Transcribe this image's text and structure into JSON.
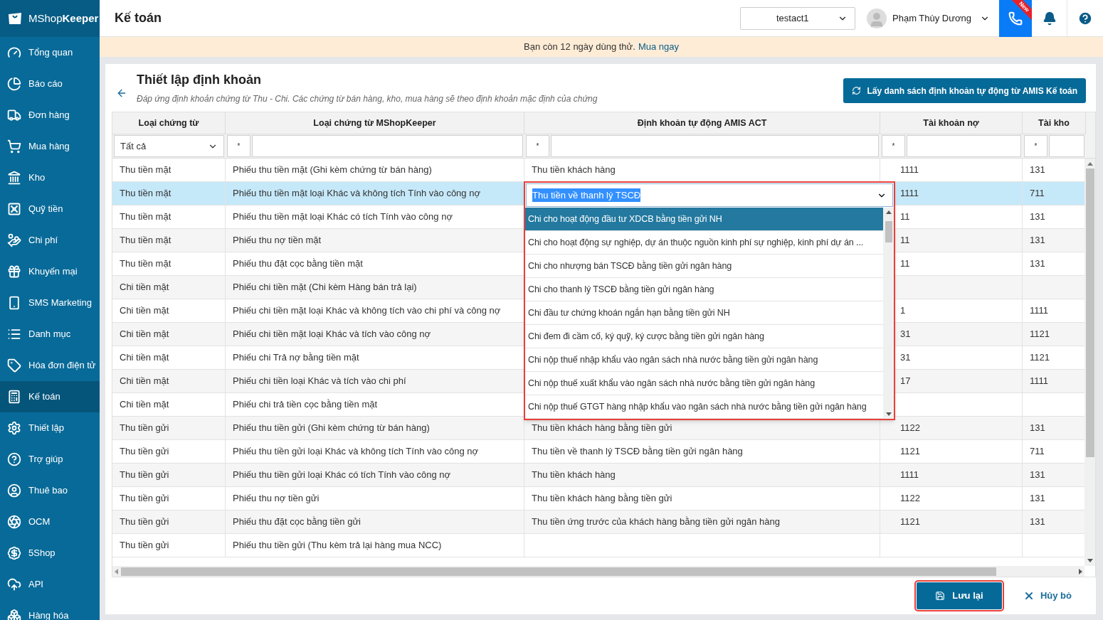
{
  "sidebar": {
    "logo": "MShop**Keeper**",
    "items": [
      {
        "label": "Tổng quan",
        "selected": false
      },
      {
        "label": "Báo cáo",
        "selected": false
      },
      {
        "label": "Đơn hàng",
        "selected": false
      },
      {
        "label": "Mua hàng",
        "selected": false
      },
      {
        "label": "Kho",
        "selected": false
      },
      {
        "label": "Quỹ tiền",
        "selected": false
      },
      {
        "label": "Chi phí",
        "selected": false
      },
      {
        "label": "Khuyến mại",
        "selected": false
      },
      {
        "label": "SMS Marketing",
        "selected": false
      },
      {
        "label": "Danh mục",
        "selected": false
      },
      {
        "label": "Hóa đơn điện tử",
        "selected": false
      },
      {
        "label": "Kế toán",
        "selected": true
      },
      {
        "label": "Thiết lập",
        "selected": false
      },
      {
        "label": "Trợ giúp",
        "selected": false
      },
      {
        "label": "Thuê bao",
        "selected": false
      },
      {
        "label": "OCM",
        "selected": false
      },
      {
        "label": "5Shop",
        "selected": false
      },
      {
        "label": "API",
        "selected": false
      },
      {
        "label": "Hàng hóa",
        "selected": false
      }
    ]
  },
  "topbar": {
    "title": "Kế toán",
    "account": "testact1",
    "user": "Phạm Thùy Dương",
    "new_badge": "New"
  },
  "notice": {
    "text": "Bạn còn 12 ngày dùng thử.",
    "link": "Mua ngay"
  },
  "page": {
    "title": "Thiết lập định khoản",
    "subtitle": "Đáp ứng định khoản chứng từ Thu - Chi. Các chứng từ bán hàng, kho, mua hàng sẽ theo định khoản mặc định của chứng",
    "fetch_button": "Lấy danh sách định khoản tự động từ AMIS Kế toán"
  },
  "table": {
    "columns": [
      "Loại chứng từ",
      "Loại chứng từ MShopKeeper",
      "Định khoản tự động AMIS ACT",
      "Tài khoản nợ",
      "Tài kho"
    ],
    "filters": [
      {
        "kind": "select",
        "value": "Tất cả"
      },
      {
        "kind": "text",
        "operator": "*"
      },
      {
        "kind": "text",
        "operator": "*"
      },
      {
        "kind": "text",
        "operator": "*"
      },
      {
        "kind": "text",
        "operator": "*"
      }
    ],
    "rows": [
      {
        "type": "Thu tiền mặt",
        "doc": "Phiếu thu tiền mặt (Ghi kèm chứng từ bán hàng)",
        "amis": "Thu tiền khách hàng",
        "debit": "1111",
        "credit": "131",
        "selected": false
      },
      {
        "type": "Thu tiền mặt",
        "doc": "Phiếu thu tiền mặt loại Khác và không tích Tính vào công nợ",
        "debit": "1111",
        "credit": "711",
        "selected": true
      },
      {
        "type": "Thu tiền mặt",
        "doc": "Phiếu thu tiền mặt loại Khác có tích Tính vào công nợ",
        "debit": "11",
        "credit": "131",
        "selected": false
      },
      {
        "type": "Thu tiền mặt",
        "doc": "Phiếu thu nợ tiền mặt",
        "debit": "11",
        "credit": "131",
        "selected": false
      },
      {
        "type": "Thu tiền mặt",
        "doc": "Phiếu thu đặt cọc bằng tiền mặt",
        "debit": "11",
        "credit": "131",
        "selected": false
      },
      {
        "type": "Chi tiền mặt",
        "doc": "Phiếu chi tiền mặt (Chi kèm Hàng bán trả lại)",
        "selected": false
      },
      {
        "type": "Chi tiền mặt",
        "doc": "Phiếu chi tiền mặt loại Khác và không tích vào chi phí và công nợ",
        "debit": "1",
        "credit": "1111",
        "selected": false
      },
      {
        "type": "Chi tiền mặt",
        "doc": "Phiếu chi tiền mặt loại Khác và tích vào công nợ",
        "debit": "31",
        "credit": "1121",
        "selected": false
      },
      {
        "type": "Chi tiền mặt",
        "doc": "Phiếu chi Trả nợ bằng tiền mặt",
        "debit": "31",
        "credit": "1121",
        "selected": false
      },
      {
        "type": "Chi tiền mặt",
        "doc": "Phiếu chi tiền loại Khác và tích vào chi phí",
        "debit": "17",
        "credit": "1111",
        "selected": false
      },
      {
        "type": "Chi tiền mặt",
        "doc": "Phiếu chi trả tiền cọc bằng tiền mặt",
        "selected": false
      },
      {
        "type": "Thu tiền gửi",
        "doc": "Phiếu thu tiền gửi (Ghi kèm chứng từ bán hàng)",
        "amis": "Thu tiền khách hàng bằng tiền gửi",
        "debit": "1122",
        "credit": "131",
        "selected": false
      },
      {
        "type": "Thu tiền gửi",
        "doc": "Phiếu thu tiền gửi loại Khác và không tích Tính vào công nợ",
        "amis": "Thu tiền về thanh lý TSCĐ bằng tiền gửi ngân hàng",
        "debit": "1121",
        "credit": "711",
        "selected": false
      },
      {
        "type": "Thu tiền gửi",
        "doc": "Phiếu thu tiền gửi loại Khác có tích Tính vào công nợ",
        "amis": "Thu tiền khách hàng",
        "debit": "1111",
        "credit": "131",
        "selected": false
      },
      {
        "type": "Thu tiền gửi",
        "doc": "Phiếu thu nợ tiền gửi",
        "amis": "Thu tiền khách hàng bằng tiền gửi",
        "debit": "1122",
        "credit": "131",
        "selected": false
      },
      {
        "type": "Thu tiền gửi",
        "doc": "Phiếu thu đặt cọc bằng tiền gửi",
        "amis": "Thu tiền ứng trước của khách hàng bằng tiền gửi ngân hàng",
        "debit": "1121",
        "credit": "131",
        "selected": false
      },
      {
        "type": "Thu tiền gửi",
        "doc": "Phiếu thu tiền gửi (Thu kèm trả lại hàng mua NCC)",
        "selected": false
      }
    ],
    "dropdown": {
      "value": "Thu tiền về thanh lý TSCĐ",
      "options": [
        {
          "label": "Chi cho hoạt động đầu tư XDCB bằng tiền gửi NH",
          "selected": true
        },
        {
          "label": "Chi cho hoạt động sự nghiệp, dự án thuộc nguồn kinh phí sự nghiệp, kinh phí dự án ...",
          "selected": false
        },
        {
          "label": "Chi cho nhượng bán TSCĐ bằng tiền gửi ngân hàng",
          "selected": false
        },
        {
          "label": "Chi cho thanh lý TSCĐ bằng tiền gửi ngân hàng",
          "selected": false
        },
        {
          "label": "Chi đầu tư chứng khoán ngắn hạn bằng tiền gửi NH",
          "selected": false
        },
        {
          "label": "Chi đem đi cầm cố, ký quỹ, ký cược bằng tiền gửi ngân hàng",
          "selected": false
        },
        {
          "label": "Chi nộp thuế nhập khẩu vào ngân sách nhà nước bằng tiền gửi ngân hàng",
          "selected": false
        },
        {
          "label": "Chi nộp thuế xuất khẩu vào ngân sách nhà nước bằng tiền gửi ngân hàng",
          "selected": false
        },
        {
          "label": "Chi nộp thuế GTGT hàng nhập khẩu vào ngân sách nhà nước bằng tiền gửi ngân hàng",
          "selected": false
        }
      ]
    }
  },
  "footer": {
    "save": "Lưu lại",
    "cancel": "Hủy bỏ"
  }
}
